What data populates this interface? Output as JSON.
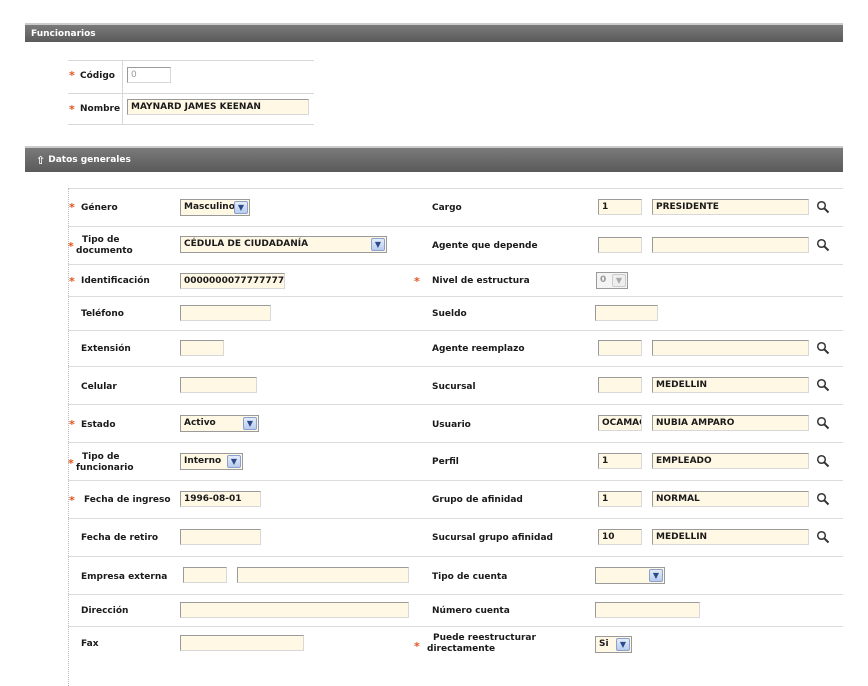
{
  "section1": {
    "title": "Funcionarios"
  },
  "code": {
    "label": "Código",
    "value": "0"
  },
  "name": {
    "label": "Nombre",
    "value": "MAYNARD JAMES KEENAN"
  },
  "section2": {
    "title": "Datos generales"
  },
  "left": {
    "genero": {
      "label": "Género",
      "value": "Masculino"
    },
    "tipo_doc": {
      "label1": "Tipo de",
      "label2": "documento",
      "value": "CÉDULA DE CIUDADANÍA"
    },
    "identificacion": {
      "label": "Identificación",
      "value": "0000000077777777"
    },
    "telefono": {
      "label": "Teléfono",
      "value": ""
    },
    "extension": {
      "label": "Extensión",
      "value": ""
    },
    "celular": {
      "label": "Celular",
      "value": ""
    },
    "estado": {
      "label": "Estado",
      "value": "Activo"
    },
    "tipo_func": {
      "label1": "Tipo de",
      "label2": "funcionario",
      "value": "Interno"
    },
    "fecha_ingreso": {
      "label": "Fecha de ingreso",
      "value": "1996-08-01"
    },
    "fecha_retiro": {
      "label": "Fecha de retiro",
      "value": ""
    },
    "empresa_externa": {
      "label": "Empresa externa",
      "code": "",
      "value": ""
    },
    "direccion": {
      "label": "Dirección",
      "value": ""
    },
    "fax": {
      "label": "Fax",
      "value": ""
    }
  },
  "right": {
    "cargo": {
      "label": "Cargo",
      "code": "1",
      "value": "PRESIDENTE"
    },
    "agente_depende": {
      "label": "Agente que depende",
      "code": "",
      "value": ""
    },
    "nivel": {
      "label": "Nivel de estructura",
      "value": "0"
    },
    "sueldo": {
      "label": "Sueldo",
      "value": ""
    },
    "agente_reemplazo": {
      "label": "Agente reemplazo",
      "code": "",
      "value": ""
    },
    "sucursal": {
      "label": "Sucursal",
      "code": "",
      "value": "MEDELLIN"
    },
    "usuario": {
      "label": "Usuario",
      "code": "OCAMAC",
      "value": "NUBIA AMPARO"
    },
    "perfil": {
      "label": "Perfil",
      "code": "1",
      "value": "EMPLEADO"
    },
    "grupo_afinidad": {
      "label": "Grupo de afinidad",
      "code": "1",
      "value": "NORMAL"
    },
    "sucursal_grupo": {
      "label": "Sucursal grupo afinidad",
      "code": "10",
      "value": "MEDELLIN"
    },
    "tipo_cuenta": {
      "label": "Tipo de cuenta",
      "value": ""
    },
    "numero_cuenta": {
      "label": "Número cuenta",
      "value": ""
    },
    "reestructurar": {
      "label1": "Puede reestructurar",
      "label2": "directamente",
      "value": "Si"
    }
  },
  "colors": {
    "header": "#6a6a6a",
    "required": "#e2531d",
    "input_bg": "#fff8e5"
  }
}
